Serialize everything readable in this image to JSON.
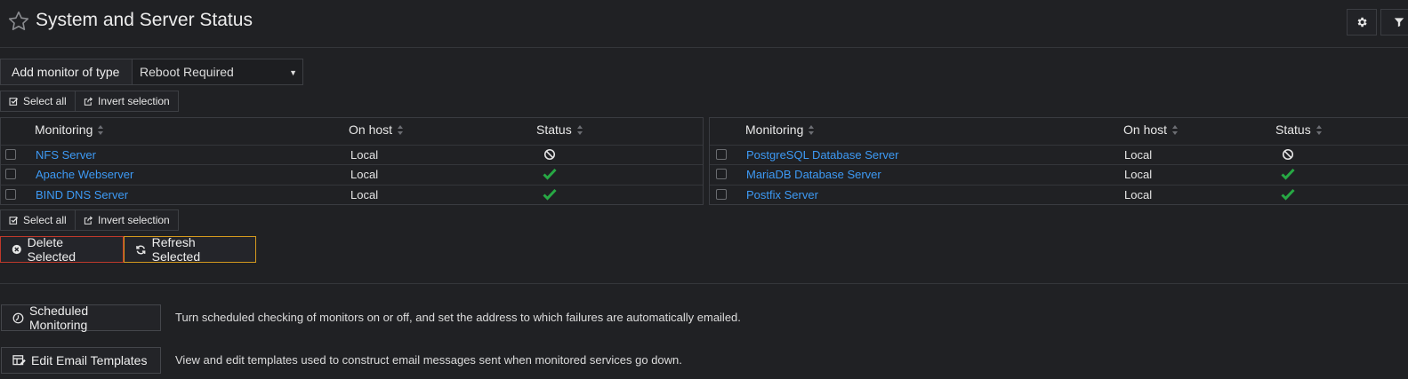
{
  "header": {
    "title": "System and Server Status"
  },
  "add_monitor": {
    "label": "Add monitor of type",
    "selected": "Reboot Required"
  },
  "selection": {
    "select_all": "Select all",
    "invert": "Invert selection"
  },
  "columns": {
    "monitoring": "Monitoring",
    "on_host": "On host",
    "status": "Status"
  },
  "left_rows": [
    {
      "name": "NFS Server",
      "host": "Local",
      "status": "disabled"
    },
    {
      "name": "Apache Webserver",
      "host": "Local",
      "status": "ok"
    },
    {
      "name": "BIND DNS Server",
      "host": "Local",
      "status": "ok"
    }
  ],
  "right_rows": [
    {
      "name": "PostgreSQL Database Server",
      "host": "Local",
      "status": "disabled"
    },
    {
      "name": "MariaDB Database Server",
      "host": "Local",
      "status": "ok"
    },
    {
      "name": "Postfix Server",
      "host": "Local",
      "status": "ok"
    }
  ],
  "actions": {
    "delete": "Delete Selected",
    "refresh": "Refresh Selected"
  },
  "bottom": {
    "scheduled_label": "Scheduled Monitoring",
    "scheduled_desc": "Turn scheduled checking of monitors on or off, and set the address to which failures are automatically emailed.",
    "templates_label": "Edit Email Templates",
    "templates_desc": "View and edit templates used to construct email messages sent when monitored services go down."
  },
  "colors": {
    "background": "#202124",
    "link": "#3d9af5",
    "ok_check": "#27a844",
    "delete_border": "#c0392b",
    "refresh_border": "#d59a1e"
  },
  "icons": {
    "title": "star-outline-icon",
    "settings": "gear-icon",
    "filter": "filter-icon",
    "status_ok": "checkmark-icon",
    "status_disabled": "ban-icon"
  }
}
